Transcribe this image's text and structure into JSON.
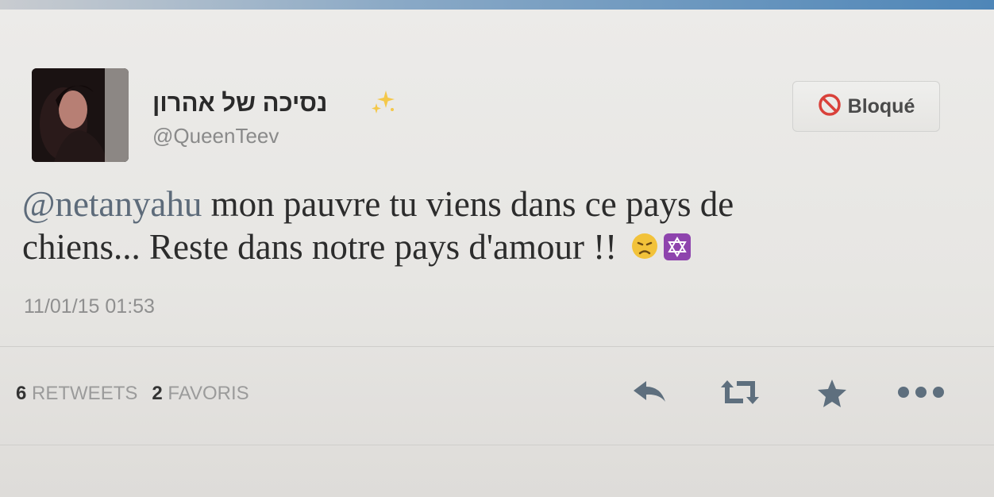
{
  "profile": {
    "display_name": "נסיכה של אהרון",
    "username": "@QueenTeev",
    "avatar_icon": "profile-photo"
  },
  "block_button": {
    "label": "Bloqué",
    "icon": "block-icon"
  },
  "tweet": {
    "mention": "@netanyahu",
    "text_line1_rest": " mon pauvre tu viens dans ce pays de",
    "text_line2": "chiens... Reste dans notre pays d'amour !!",
    "emojis": [
      "disappointed-face-emoji",
      "star-of-david-emoji"
    ],
    "timestamp": "11/01/15 01:53"
  },
  "stats": {
    "retweets_count": "6",
    "retweets_label": "RETWEETS",
    "favorites_count": "2",
    "favorites_label": "FAVORIS"
  },
  "actions": [
    "reply-icon",
    "retweet-icon",
    "favorite-icon",
    "more-icon"
  ],
  "colors": {
    "block_icon": "#d9413a",
    "emoji_sad": "#f2c23a",
    "emoji_star_bg": "#8e44ad",
    "action_icons": "#5e6f7e"
  }
}
